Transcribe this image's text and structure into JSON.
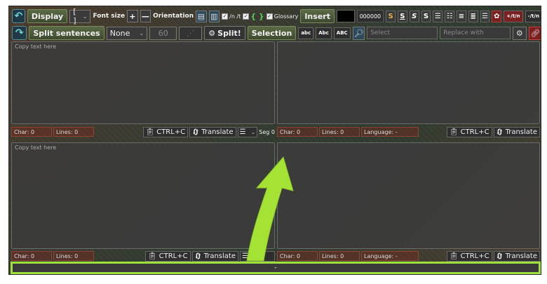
{
  "toolbar": {
    "row1": {
      "display_label": "Display",
      "display_value": "[ ]",
      "font_size_label": "Font size",
      "plus": "+",
      "minus": "—",
      "orientation_label": "Orientation",
      "newline_toggle": "/n /t",
      "brace_toggle": "{ }",
      "glossary_label": "Glossary",
      "insert_label": "Insert",
      "insert_color": "#000000",
      "color_value": "000000",
      "fmt_s_gold": "S",
      "fmt_s_under": "S",
      "fmt_s_italic": "S",
      "fmt_s_plain": "S",
      "nt_label": "+/t/n",
      "nt_remove_label": "-/t/n"
    },
    "row2": {
      "split_label": "Split sentences",
      "split_value": "None",
      "number_value": "60",
      "split_button": "Split!",
      "selection_label": "Selection",
      "case_lower": "abc",
      "case_title": "Abc",
      "case_upper": "ABC",
      "select_placeholder": "Select",
      "replace_placeholder": "Replace with"
    }
  },
  "top_left": {
    "placeholder": "Copy text here",
    "char": "Char: 0",
    "lines": "Lines: 0",
    "copy_btn": "CTRL+C",
    "translate_btn": "Translate",
    "seg": "Seg 0"
  },
  "top_right": {
    "char": "Char: 0",
    "lines": "Lines: 0",
    "language": "Language: -",
    "copy_btn": "CTRL+C",
    "translate_btn": "Translate"
  },
  "bottom_left": {
    "placeholder": "Copy text here",
    "char": "Char: 0",
    "lines": "Lines: 0",
    "copy_btn": "CTRL+C",
    "translate_btn": "Translate"
  },
  "bottom_right": {
    "char": "Char: 0",
    "lines": "Lines: 0",
    "language": "Language: -",
    "copy_btn": "CTRL+C",
    "translate_btn": "Translate"
  },
  "bottom_bar": {
    "text": "-"
  },
  "colors": {
    "highlight": "#9ee03c",
    "accent": "#6fd1d6"
  },
  "icons": [
    "undo-arrow-icon",
    "redo-arrow-icon",
    "clipboard-icon",
    "translate-icon",
    "align-icon",
    "magnifier-icon",
    "settings-icon",
    "link-icon",
    "cursor-arrow-icon"
  ]
}
